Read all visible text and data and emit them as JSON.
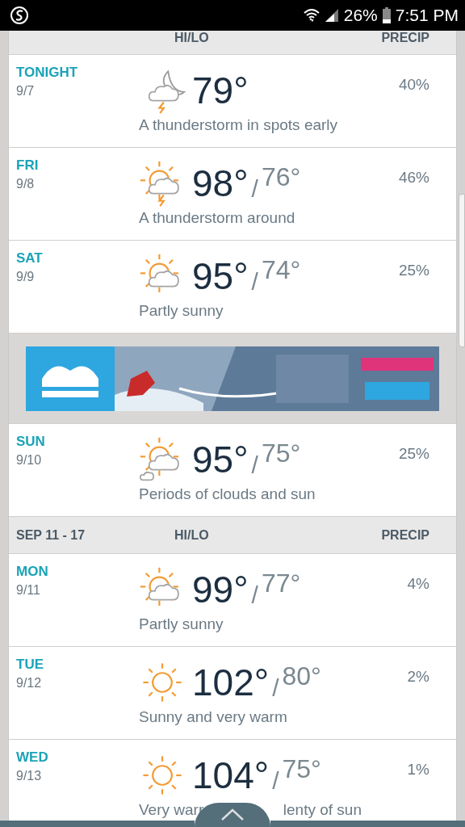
{
  "status_bar": {
    "battery": "26%",
    "time": "7:51 PM"
  },
  "sections": [
    {
      "kind": "header",
      "hilo": "HI/LO",
      "precip": "PRECIP"
    },
    {
      "kind": "night-storm",
      "name": "TONIGHT",
      "date": "9/7",
      "high": "79°",
      "precip": "40%",
      "description": "A thunderstorm in spots early"
    },
    {
      "kind": "storm",
      "name": "FRI",
      "date": "9/8",
      "high": "98°",
      "separator": "/",
      "low": "76°",
      "precip": "46%",
      "description": "A thunderstorm around"
    },
    {
      "kind": "partly-sunny",
      "name": "SAT",
      "date": "9/9",
      "high": "95°",
      "separator": "/",
      "low": "74°",
      "precip": "25%",
      "description": "Partly sunny"
    },
    {
      "kind": "ad"
    },
    {
      "kind": "mixed",
      "name": "SUN",
      "date": "9/10",
      "high": "95°",
      "separator": "/",
      "low": "75°",
      "precip": "25%",
      "description": "Periods of clouds and sun"
    },
    {
      "kind": "header",
      "label": "SEP 11 - 17",
      "hilo": "HI/LO",
      "precip": "PRECIP"
    },
    {
      "kind": "partly-sunny",
      "name": "MON",
      "date": "9/11",
      "high": "99°",
      "separator": "/",
      "low": "77°",
      "precip": "4%",
      "description": "Partly sunny"
    },
    {
      "kind": "sunny",
      "name": "TUE",
      "date": "9/12",
      "high": "102°",
      "separator": "/",
      "low": "80°",
      "precip": "2%",
      "description": "Sunny and very warm"
    },
    {
      "kind": "sunny",
      "name": "WED",
      "date": "9/13",
      "high": "104°",
      "separator": "/",
      "low": "75°",
      "precip": "1%",
      "description": "Very warr",
      "description_tail": "lenty of sun"
    }
  ]
}
